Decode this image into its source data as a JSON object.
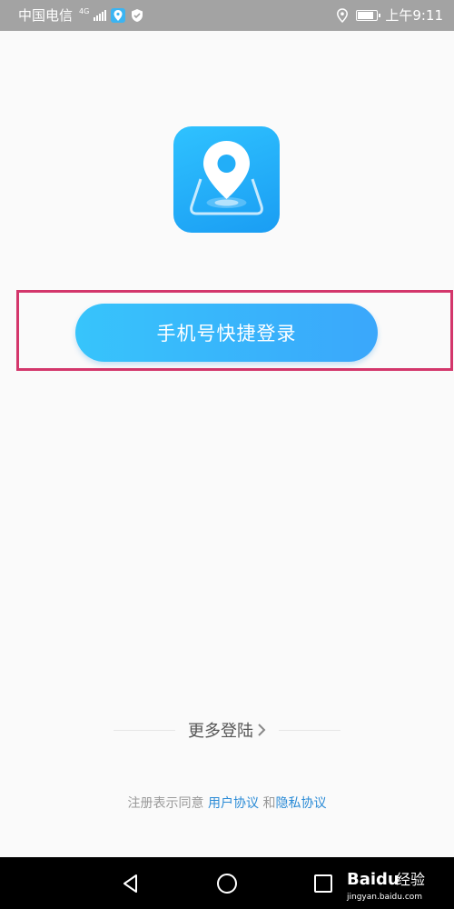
{
  "status_bar": {
    "carrier": "中国电信",
    "network": "4G",
    "time": "上午9:11"
  },
  "icons": {
    "app_logo": "location-pin-icon",
    "more_login_chevron": "chevron-right-icon",
    "location_status": "location-icon",
    "battery": "battery-icon"
  },
  "login": {
    "button_label": "手机号快捷登录"
  },
  "more_login": {
    "label": "更多登陆"
  },
  "agreement": {
    "prefix": "注册表示同意 ",
    "user_agreement": "用户协议",
    "conjunction": " 和",
    "privacy_policy": "隐私协议"
  },
  "watermark": {
    "brand": "Baidu",
    "cn": "经验",
    "url": "jingyan.baidu.com"
  },
  "colors": {
    "accent": "#37c4fb",
    "link": "#2b8bd6",
    "highlight": "#d3366b",
    "status_bar": "#a3a3a3"
  }
}
